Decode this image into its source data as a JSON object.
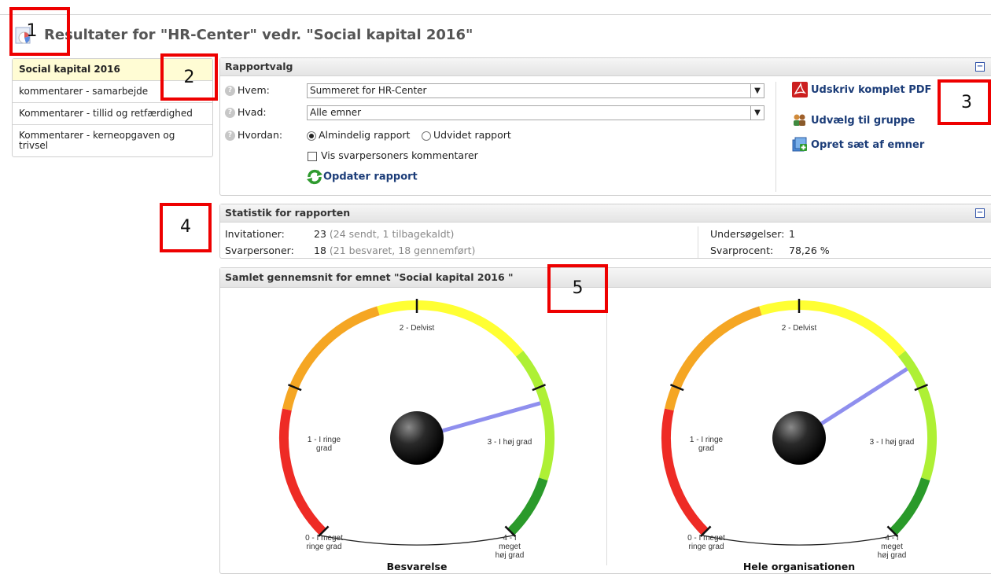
{
  "page": {
    "title": "Resultater for \"HR-Center\" vedr. \"Social kapital 2016\""
  },
  "markers": [
    "1",
    "2",
    "3",
    "4",
    "5"
  ],
  "sidebar": {
    "items": [
      {
        "label": "Social kapital 2016"
      },
      {
        "label": "kommentarer - samarbejde"
      },
      {
        "label": "Kommentarer - tillid og retfærdighed"
      },
      {
        "label": "Kommentarer - kerneopgaven og trivsel"
      }
    ]
  },
  "rapportvalg": {
    "title": "Rapportvalg",
    "collapse": "−",
    "hvem": {
      "label": "Hvem:",
      "value": "Summeret for HR-Center"
    },
    "hvad": {
      "label": "Hvad:",
      "value": "Alle emner"
    },
    "hvordan": {
      "label": "Hvordan:",
      "option1": "Almindelig rapport",
      "option2": "Udvidet rapport",
      "selected": "Almindelig rapport"
    },
    "checkbox": "Vis svarpersoners kommentarer",
    "update": "Opdater rapport",
    "actions": {
      "pdf": "Udskriv komplet PDF",
      "group": "Udvælg til gruppe",
      "set": "Opret sæt af emner"
    }
  },
  "statistik": {
    "title": "Statistik for rapporten",
    "collapse": "−",
    "invitationer": {
      "label": "Invitationer:",
      "value": "23",
      "note": "(24 sendt, 1 tilbagekaldt)"
    },
    "svarpersoner": {
      "label": "Svarpersoner:",
      "value": "18",
      "note": "(21 besvaret, 18 gennemført)"
    },
    "undersogelser": {
      "label": "Undersøgelser:",
      "value": "1"
    },
    "svarprocent": {
      "label": "Svarprocent:",
      "value": "78,26 %"
    }
  },
  "gauges": {
    "title": "Samlet gennemsnit for emnet \"Social kapital 2016 \"",
    "scale_labels": {
      "l0": [
        "0 - I meget",
        "ringe grad"
      ],
      "l1": [
        "1 - I ringe",
        "grad"
      ],
      "l2": [
        "2 - Delvist"
      ],
      "l3": [
        "3 - I høj grad"
      ],
      "l4": [
        "4 - I",
        "meget",
        "høj grad"
      ]
    },
    "items": [
      {
        "caption": "Besvarelse",
        "value": 3.1
      },
      {
        "caption": "Hele organisationen",
        "value": 2.85
      }
    ],
    "colors": [
      "#ee2b25",
      "#f5a623",
      "#ffff33",
      "#aef035",
      "#2a9a2a"
    ]
  }
}
